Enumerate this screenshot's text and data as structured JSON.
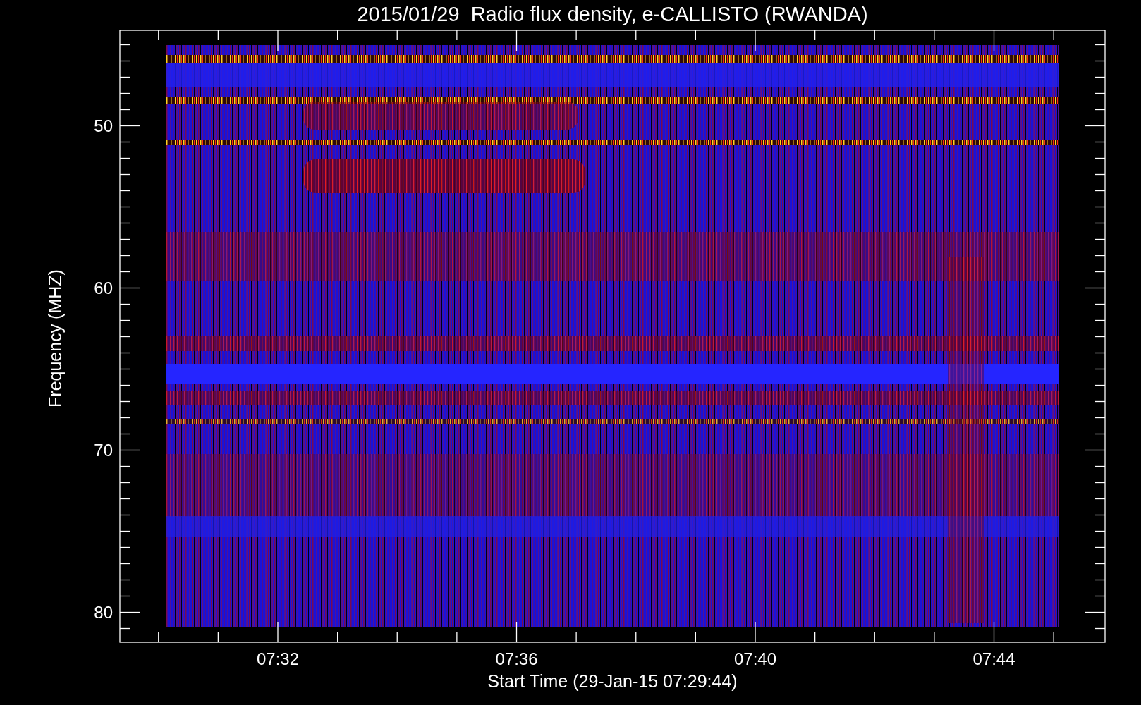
{
  "title": "2015/01/29  Radio flux density, e-CALLISTO (RWANDA)",
  "y_axis": {
    "label": "Frequency (MHZ)",
    "ticks": [
      "50",
      "60",
      "70",
      "80"
    ]
  },
  "x_axis": {
    "label": "Start Time (29-Jan-15 07:29:44)",
    "ticks": [
      "07:32",
      "07:36",
      "07:40",
      "07:44"
    ]
  }
}
